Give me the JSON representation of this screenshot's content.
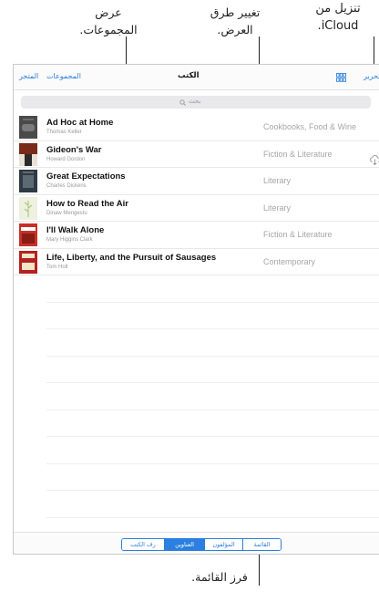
{
  "callouts": {
    "groups_line1": "عرض",
    "groups_line2": "المجموعات.",
    "view_line1": "تغيير طرق",
    "view_line2": "العرض.",
    "icloud_line1": "تنزيل من",
    "icloud_line2": "iCloud.",
    "sort_line1": "فرز القائمة."
  },
  "nav": {
    "store": "المتجر",
    "collections": "المجموعات",
    "title": "الكتب",
    "edit": "تحرير",
    "grid_icon": "grid-icon"
  },
  "search": {
    "placeholder": "بحث",
    "icon": "search-icon"
  },
  "books": [
    {
      "title": "Ad Hoc at Home",
      "author": "Thomas Keller",
      "genre": "Cookbooks, Food & Wine",
      "cover_color": "#4a4a4a"
    },
    {
      "title": "Gideon's War",
      "author": "Howard Gordon",
      "genre": "Fiction & Literature",
      "cover_color": "#6b2a1c"
    },
    {
      "title": "Great Expectations",
      "author": "Charles Dickens",
      "genre": "Literary",
      "cover_color": "#2f3a44"
    },
    {
      "title": "How to Read the Air",
      "author": "Dinaw Mengestu",
      "genre": "Literary",
      "cover_color": "#e9ead9"
    },
    {
      "title": "I'll Walk Alone",
      "author": "Mary Higgins Clark",
      "genre": "Fiction & Literature",
      "cover_color": "#c7302a"
    },
    {
      "title": "Life, Liberty, and the Pursuit of Sausages",
      "author": "Tom Holt",
      "genre": "Contemporary",
      "cover_color": "#b5211f"
    }
  ],
  "download_icon": "icloud-download-icon",
  "sort": {
    "options": [
      "القائمة",
      "المؤلفون",
      "العناوين",
      "رف الكتب"
    ],
    "selected": "العناوين",
    "accent": "#2a7fe0"
  }
}
